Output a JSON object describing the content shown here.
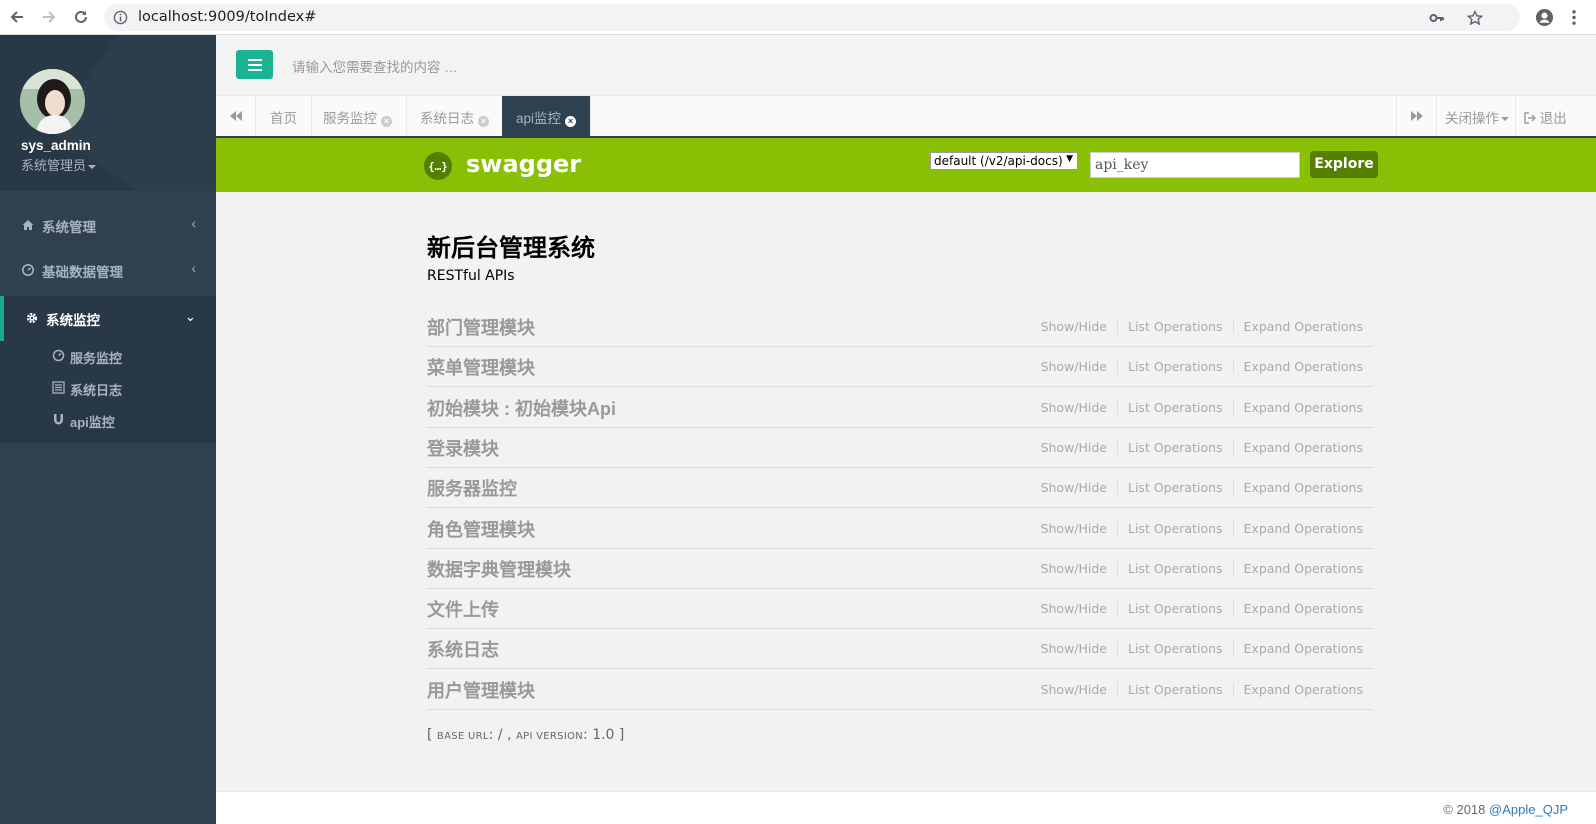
{
  "browser": {
    "url": "localhost:9009/toIndex#"
  },
  "sidebar": {
    "user_name": "sys_admin",
    "user_role": "系统管理员",
    "menu": [
      {
        "label": "系统管理",
        "icon": "home-icon"
      },
      {
        "label": "基础数据管理",
        "icon": "dashboard-icon"
      },
      {
        "label": "系统监控",
        "icon": "gear-icon"
      }
    ],
    "submenu": [
      {
        "label": "服务监控",
        "icon": "clock-icon"
      },
      {
        "label": "系统日志",
        "icon": "list-icon"
      },
      {
        "label": "api监控",
        "icon": "magnet-icon"
      }
    ]
  },
  "header": {
    "search_placeholder": "请输入您需要查找的内容 …"
  },
  "tabs": {
    "items": [
      "首页",
      "服务监控",
      "系统日志",
      "api监控"
    ],
    "active": "api监控",
    "close_ops_label": "关闭操作",
    "logout_label": "退出"
  },
  "swagger": {
    "logo_text": "{…}",
    "title": "swagger",
    "spec_select": "default (/v2/api-docs)",
    "api_key_placeholder": "api_key",
    "explore_label": "Explore",
    "api_title": "新后台管理系统",
    "api_desc": "RESTful APIs",
    "op_show_hide": "Show/Hide",
    "op_list": "List Operations",
    "op_expand": "Expand Operations",
    "resources": [
      "部门管理模块",
      "菜单管理模块",
      "初始模块 : 初始模块Api",
      "登录模块",
      "服务器监控",
      "角色管理模块",
      "数据字典管理模块",
      "文件上传",
      "系统日志",
      "用户管理模块"
    ],
    "base_url_label": "base url",
    "base_url": "/",
    "api_version_label": "api version",
    "api_version": "1.0"
  },
  "footer": {
    "copyright": "© 2018",
    "author_link": "@Apple_QJP"
  },
  "colors": {
    "sidebar_bg": "#2f4050",
    "accent_green": "#1ab394",
    "swagger_green": "#89bf04"
  }
}
